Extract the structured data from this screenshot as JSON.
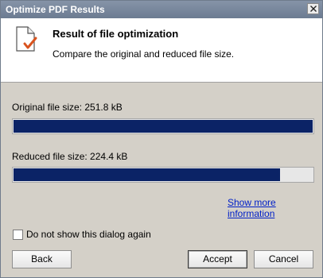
{
  "window": {
    "title": "Optimize PDF Results"
  },
  "header": {
    "title": "Result of file optimization",
    "subtitle": "Compare the original and reduced file size."
  },
  "original": {
    "label": "Original file size: 251.8 kB",
    "fill_fraction": 1.0
  },
  "reduced": {
    "label": "Reduced file size: 224.4 kB",
    "fill_fraction": 0.891
  },
  "more_info_link": "Show more information",
  "checkbox": {
    "label": "Do not show this dialog again",
    "checked": false
  },
  "buttons": {
    "back": "Back",
    "accept": "Accept",
    "cancel": "Cancel"
  },
  "colors": {
    "bar_fill": "#0b2366",
    "link": "#0020c8",
    "titlebar": "#6e7f97"
  },
  "icons": {
    "header": "document-check-icon",
    "close": "close-icon"
  }
}
